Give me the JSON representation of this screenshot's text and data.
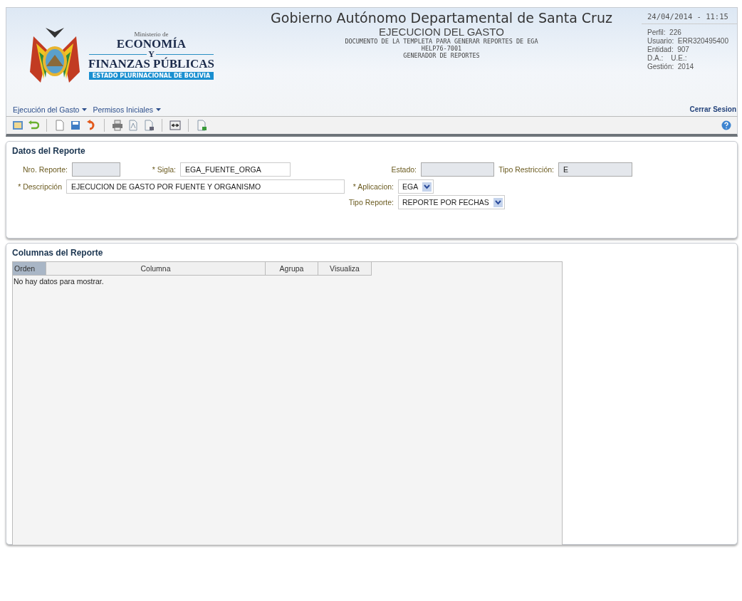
{
  "logo": {
    "line_1": "Ministerio de",
    "line_2": "ECONOMÍA",
    "line_3": "Y",
    "line_4": "FINANZAS PÚBLICAS",
    "banner": "ESTADO PLURINACIONAL DE BOLIVIA"
  },
  "header": {
    "title": "Gobierno Autónomo Departamental de Santa Cruz",
    "subtitle": "EJECUCION DEL GASTO",
    "lines": [
      "DOCUMENTO DE LA TEMPLETA PARA GENERAR REPORTES DE EGA",
      "HELP76-7001",
      "GENERADOR DE REPORTES"
    ]
  },
  "session": {
    "datetime": "24/04/2014 - 11:15",
    "info": [
      "Perfil:  226",
      "Usuario:  ERR320495400",
      "Entidad:  907",
      "D.A.:    U.E.:",
      "Gestión:  2014"
    ],
    "logout": "Cerrar Sesion"
  },
  "menu": [
    {
      "label": "Ejecución del Gasto"
    },
    {
      "label": "Permisos Iniciales"
    }
  ],
  "toolbar": [
    {
      "kind": "picture"
    },
    {
      "kind": "undo"
    },
    {
      "kind": "sep"
    },
    {
      "kind": "page"
    },
    {
      "kind": "save"
    },
    {
      "kind": "redo"
    },
    {
      "kind": "sep"
    },
    {
      "kind": "print"
    },
    {
      "kind": "pdf"
    },
    {
      "kind": "export"
    },
    {
      "kind": "sep"
    },
    {
      "kind": "fit"
    },
    {
      "kind": "sep"
    },
    {
      "kind": "excel"
    }
  ],
  "report": {
    "title": "Datos del Reporte",
    "nro": {
      "label": "Nro. Reporte:",
      "disabled": true
    },
    "sigla": {
      "label": "* Sigla:",
      "value": "EGA_FUENTE_ORGA"
    },
    "estado": {
      "label": "Estado:",
      "disabled": true
    },
    "restriccion": {
      "label": "Tipo Restricción:",
      "value": "E",
      "disabled": true
    },
    "descripcion": {
      "label": "* Descripción",
      "value": "EJECUCION DE GASTO POR FUENTE Y ORGANISMO"
    },
    "aplicacion": {
      "label": "* Aplicacion:",
      "value": "EGA"
    },
    "tipo": {
      "label": "Tipo Reporte:",
      "value": "REPORTE POR FECHAS"
    }
  },
  "columns": {
    "title": "Columnas del Reporte",
    "headers": [
      {
        "label": "Orden",
        "selected": true
      },
      {
        "label": "Columna",
        "selected": false
      },
      {
        "label": "Agrupa",
        "selected": false
      },
      {
        "label": "Visualiza",
        "selected": false
      }
    ],
    "empty": "No hay datos para mostrar."
  }
}
